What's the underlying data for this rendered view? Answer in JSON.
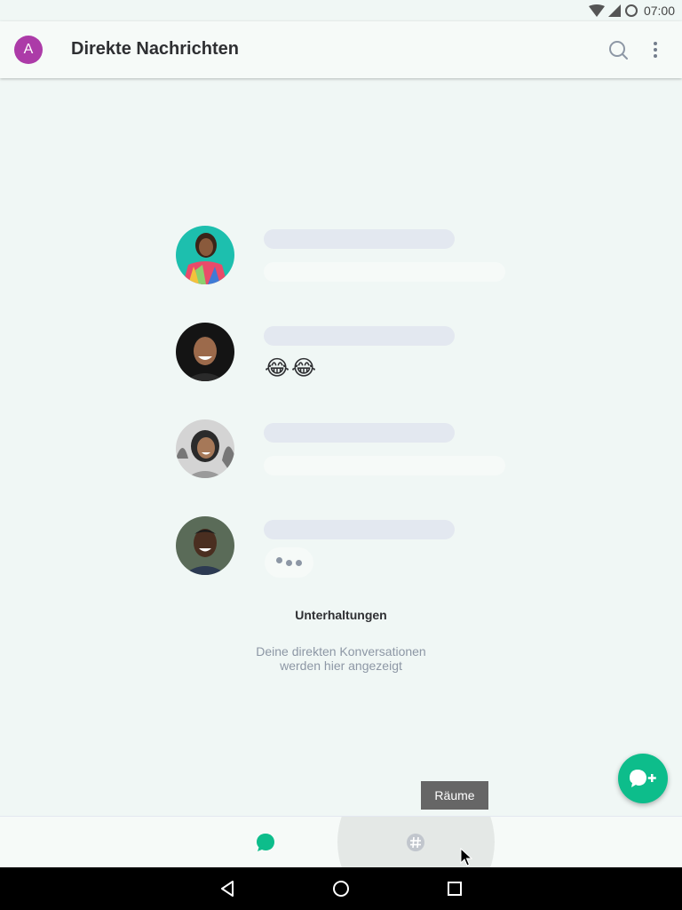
{
  "status_bar": {
    "time": "07:00",
    "icons": [
      "wifi-icon",
      "signal-icon",
      "battery-icon"
    ]
  },
  "app_bar": {
    "avatar_letter": "A",
    "title": "Direkte Nachrichten",
    "avatar_color": "#ac3ba8",
    "icons": [
      "search-icon",
      "more-vert-icon"
    ]
  },
  "placeholder_rows": [
    {
      "avatar": "woman-avatar-colorful"
    },
    {
      "avatar": "man-avatar-laughing",
      "emoji": [
        "😂",
        "😂"
      ]
    },
    {
      "avatar": "woman-avatar-smiling"
    },
    {
      "avatar": "man-avatar-smiling",
      "typing_indicator": true
    }
  ],
  "empty_state": {
    "title": "Unterhaltungen",
    "description": "Deine direkten Konversationen werden hier angezeigt"
  },
  "fab": {
    "icon": "new-chat-icon",
    "color": "#0dbd8b"
  },
  "tooltip": {
    "text": "Räume"
  },
  "bottom_nav": {
    "items": [
      {
        "icon": "chat-bubble-icon",
        "active": true,
        "color": "#0dbd8b"
      },
      {
        "icon": "hash-icon",
        "active": false,
        "color": "#c1c6cd"
      }
    ]
  },
  "system_nav": [
    "back-icon",
    "home-icon",
    "recents-icon"
  ]
}
